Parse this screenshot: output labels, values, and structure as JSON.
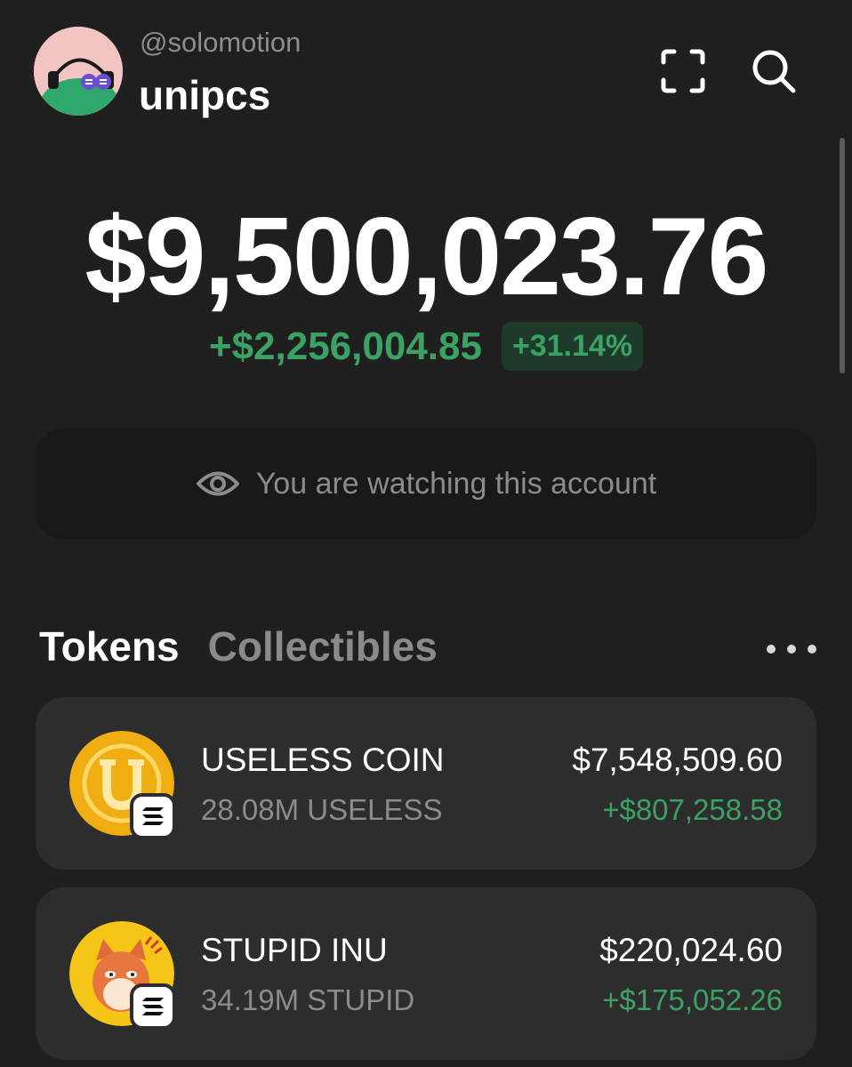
{
  "header": {
    "handle": "@solomotion",
    "username": "unipcs"
  },
  "portfolio": {
    "balance": "$9,500,023.76",
    "change_amount": "+$2,256,004.85",
    "change_percent": "+31.14%"
  },
  "watch_banner": {
    "text": "You are watching this account",
    "icon": "eye-icon"
  },
  "tabs": [
    {
      "label": "Tokens",
      "active": true
    },
    {
      "label": "Collectibles",
      "active": false
    }
  ],
  "tokens": [
    {
      "name": "USELESS COIN",
      "amount": "28.08M USELESS",
      "value": "$7,548,509.60",
      "change": "+$807,258.58",
      "logo": "useless-coin-logo",
      "chain": "solana"
    },
    {
      "name": "STUPID INU",
      "amount": "34.19M STUPID",
      "value": "$220,024.60",
      "change": "+$175,052.26",
      "logo": "stupid-inu-logo",
      "chain": "solana"
    }
  ],
  "colors": {
    "background": "#1f1f1f",
    "card": "#2d2d2d",
    "positive": "#3aa364",
    "muted": "#8c8c8c"
  }
}
